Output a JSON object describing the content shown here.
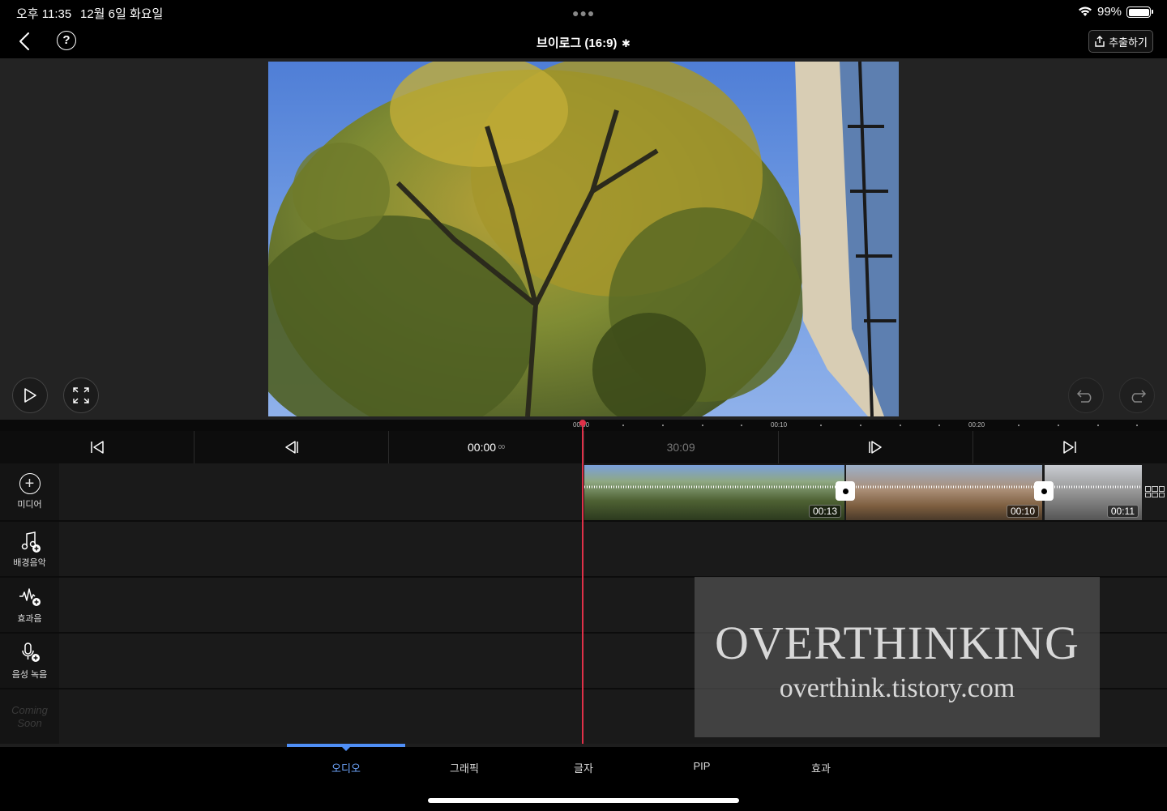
{
  "status": {
    "time": "오후 11:35",
    "date": "12월 6일 화요일",
    "battery": "99%"
  },
  "nav": {
    "title": "브이로그 (16:9)",
    "export_label": "추출하기"
  },
  "ruler": {
    "labels": [
      "00:00",
      "00:10",
      "00:20"
    ]
  },
  "controls": {
    "current_time": "00:00",
    "current_frames": "00",
    "total_time": "30:09"
  },
  "tracks": {
    "media": "미디어",
    "bgm": "배경음악",
    "sfx": "효과음",
    "voice": "음성 녹음",
    "coming_soon": "Coming Soon"
  },
  "clips": [
    {
      "duration": "00:13"
    },
    {
      "duration": "00:10"
    },
    {
      "duration": "00:11"
    }
  ],
  "watermark": {
    "title": "OVERTHINKING",
    "url": "overthink.tistory.com"
  },
  "tabs": [
    {
      "label": "오디오",
      "active": true
    },
    {
      "label": "그래픽"
    },
    {
      "label": "글자"
    },
    {
      "label": "PIP"
    },
    {
      "label": "효과"
    }
  ],
  "colors": {
    "accent": "#4f8ff7",
    "playhead": "#e03048"
  }
}
